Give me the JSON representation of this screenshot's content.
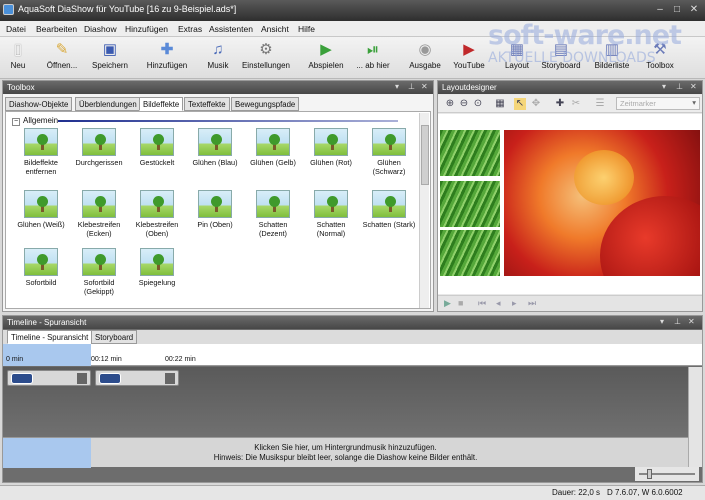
{
  "window": {
    "title": "AquaSoft DiaShow für YouTube [16 zu 9-Beispiel.ads*]"
  },
  "menu": [
    "Datei",
    "Bearbeiten",
    "Diashow",
    "Hinzufügen",
    "Extras",
    "Assistenten",
    "Ansicht",
    "Hilfe"
  ],
  "toolbar": {
    "neu": "Neu",
    "oeffnen": "Öffnen...",
    "speichern": "Speichern",
    "hinzufuegen": "Hinzufügen",
    "musik": "Musik",
    "einstellungen": "Einstellungen",
    "abspielen": "Abspielen",
    "abhier": "... ab hier",
    "ausgabe": "Ausgabe",
    "youtube": "YouTube",
    "layout": "Layout",
    "storyboard": "Storyboard",
    "bilderliste": "Bilderliste",
    "toolbox": "Toolbox"
  },
  "watermark": {
    "main": "soft-ware.net",
    "sub": "AKTUELLE DOWNLOADS"
  },
  "toolbox": {
    "title": "Toolbox",
    "tabs": [
      "Diashow-Objekte",
      "Überblendungen",
      "Bildeffekte",
      "Texteffekte",
      "Bewegungspfade"
    ],
    "active_tab": "Bildeffekte",
    "group": "Allgemein",
    "effects": [
      "Bildeffekte entfernen",
      "Durchgerissen",
      "Gestückelt",
      "Glühen (Blau)",
      "Glühen (Gelb)",
      "Glühen (Rot)",
      "Glühen (Schwarz)",
      "Glühen (Weiß)",
      "Klebestreifen (Ecken)",
      "Klebestreifen (Oben)",
      "Pin (Oben)",
      "Schatten (Dezent)",
      "Schatten (Normal)",
      "Schatten (Stark)",
      "Sofortbild",
      "Sofortbild (Gekippt)",
      "Spiegelung"
    ]
  },
  "layoutdesigner": {
    "title": "Layoutdesigner",
    "zeitmarker": "Zeitmarker"
  },
  "timeline": {
    "title": "Timeline - Spuransicht",
    "tabs": [
      "Timeline - Spuransicht",
      "Storyboard"
    ],
    "ruler": [
      "0 min",
      "00:12 min",
      "00:22 min"
    ],
    "music_hint_1": "Klicken Sie hier, um Hintergrundmusik hinzuzufügen.",
    "music_hint_2": "Hinweis: Die Musikspur bleibt leer, solange die Diashow keine Bilder enthält."
  },
  "status": {
    "dauer": "Dauer: 22,0 s",
    "version": "D 7.6.07, W 6.0.6002"
  }
}
